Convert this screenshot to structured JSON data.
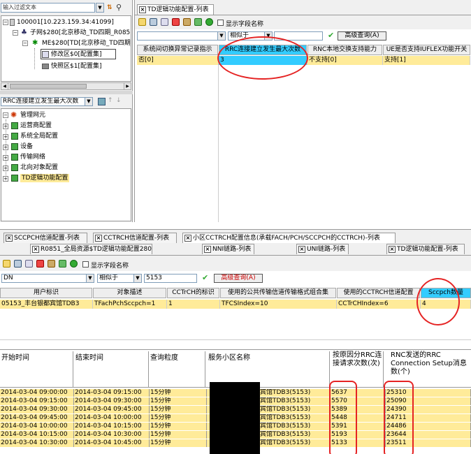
{
  "filter": {
    "placeholder": "输入过滤文本"
  },
  "tree_top": {
    "root": "100001[10.223.159.34:41099]",
    "level1": "子网$280[北京移动_TD四期_R0851]",
    "level2": "ME$280[TD[北京移动_TD四期_",
    "modify": "修改区$0[配置集]",
    "snapshot": "快照区$1[配置集]"
  },
  "param_combo": "RRC连接建立发生最大次数",
  "tree_bottom": {
    "root": "管理网元",
    "items": [
      "运营商配置",
      "系统全局配置",
      "设备",
      "传输网络",
      "北向对象配置",
      "TD逻辑功能配置"
    ]
  },
  "top_panel": {
    "tab": "TD逻辑功能配置-列表",
    "show_field_names": "显示字段名称",
    "match_op": "相似于",
    "search_btn": "高级查询(A)",
    "headers": [
      "系统间切换异常记录指示",
      "RRC连接建立发生最大次数",
      "RNC本地交换支持能力",
      "UE是否支持IUFLEX功能开关"
    ],
    "row": [
      "否[0]",
      "3",
      "不支持[0]",
      "支持[1]"
    ]
  },
  "mid_panel": {
    "tabs_row1": [
      "SCCPCH信道配置-列表",
      "CCTRCH信道配置-列表",
      "小区CCTRCH配置信息(承载FACH/PCH/SCCPCH的CCTRCH)-列表"
    ],
    "tabs_row2": [
      "R0851_全局资源$TD逻辑功能配置280",
      "NNI链路-列表",
      "UNI链路-列表",
      "TD逻辑功能配置-列表"
    ],
    "show_field_names": "显示字段名称",
    "field": "DN",
    "match_op": "相似于",
    "value": "5153",
    "search_btn": "高级查询(A)",
    "headers": [
      "用户标识",
      "对象描述",
      "CCTrCH的标识",
      "使用的公共传输信道传输格式组合集",
      "使用的CCTRCH信道配置",
      "Sccpch数量"
    ],
    "row": [
      "05153_丰台银都宾馆TDB3",
      "TFachPchSccpch=1",
      "1",
      "TFCSIndex=10",
      "CCTrCHIndex=6",
      "4"
    ]
  },
  "bottom_grid": {
    "headers": {
      "start": "开始时间",
      "end": "结束时间",
      "gran": "查询粒度",
      "cell": "服务小区名称",
      "rrc_req": "按原因分RRC连接请求次数(次)",
      "rrc_setup": "RNC发送的RRC Connection Setup消息数(个)"
    },
    "rows": [
      {
        "start": "2014-03-04 09:00:00",
        "end": "2014-03-04 09:15:00",
        "gran": "15分钟",
        "cell": "宾馆TDB3(5153)",
        "req": "5637",
        "setup": "25310"
      },
      {
        "start": "2014-03-04 09:15:00",
        "end": "2014-03-04 09:30:00",
        "gran": "15分钟",
        "cell": "宾馆TDB3(5153)",
        "req": "5570",
        "setup": "25090"
      },
      {
        "start": "2014-03-04 09:30:00",
        "end": "2014-03-04 09:45:00",
        "gran": "15分钟",
        "cell": "宾馆TDB3(5153)",
        "req": "5389",
        "setup": "24390"
      },
      {
        "start": "2014-03-04 09:45:00",
        "end": "2014-03-04 10:00:00",
        "gran": "15分钟",
        "cell": "宾馆TDB3(5153)",
        "req": "5448",
        "setup": "24711"
      },
      {
        "start": "2014-03-04 10:00:00",
        "end": "2014-03-04 10:15:00",
        "gran": "15分钟",
        "cell": "宾馆TDB3(5153)",
        "req": "5391",
        "setup": "24486"
      },
      {
        "start": "2014-03-04 10:15:00",
        "end": "2014-03-04 10:30:00",
        "gran": "15分钟",
        "cell": "宾馆TDB3(5153)",
        "req": "5193",
        "setup": "23644"
      },
      {
        "start": "2014-03-04 10:30:00",
        "end": "2014-03-04 10:45:00",
        "gran": "15分钟",
        "cell": "宾馆TDB3(5153)",
        "req": "5133",
        "setup": "23511"
      }
    ]
  },
  "colors": {
    "accent_blue": "#33ccff",
    "row_yellow": "#ffeb99",
    "highlight_red": "#e52323"
  }
}
